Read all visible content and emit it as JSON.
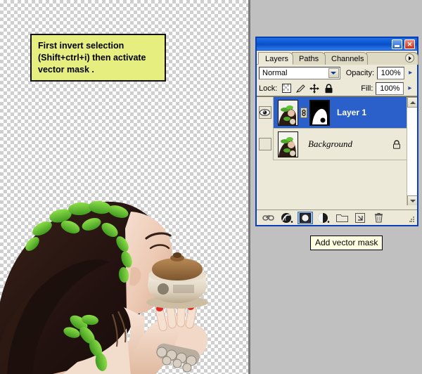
{
  "annotation_note": {
    "lines": [
      "First invert selection",
      "(Shift+ctrl+i) then activate",
      "vector mask ."
    ],
    "background_color": "#e6ee80",
    "border_color": "#111111"
  },
  "canvas": {
    "name": "transparent-canvas",
    "checker_light": "#ffffff",
    "checker_dark": "#cfcfcf",
    "photo_description": "Cut-out photo of a woman with green leaves in her hair holding a ceramic tea bowl"
  },
  "photoshop_panel": {
    "title": "",
    "window_buttons": {
      "minimize": "_",
      "close": "✕"
    },
    "tabs": [
      {
        "label": "Layers",
        "active": true
      },
      {
        "label": "Paths",
        "active": false
      },
      {
        "label": "Channels",
        "active": false
      }
    ],
    "tab_menu_icon": "triangle-right-icon",
    "blend": {
      "mode": "Normal",
      "dropdown_icon": "chevron-down-icon",
      "opacity_label": "Opacity:",
      "opacity_value": "100%",
      "opacity_flyout_icon": "chevron-right-icon"
    },
    "lock": {
      "label": "Lock:",
      "icons": [
        "lock-transparent-pixels-icon",
        "lock-image-pixels-icon",
        "lock-position-icon",
        "lock-all-icon"
      ],
      "fill_label": "Fill:",
      "fill_value": "100%",
      "fill_flyout_icon": "chevron-right-icon"
    },
    "layers": [
      {
        "name": "Layer 1",
        "visible": true,
        "selected": true,
        "has_mask": true,
        "link_icon": "link-chain-icon",
        "locked": false
      },
      {
        "name": "Background",
        "visible": false,
        "selected": false,
        "has_mask": false,
        "locked": true,
        "lock_icon": "padlock-icon"
      }
    ],
    "scrollbar": {
      "up_icon": "chevron-up-icon",
      "down_icon": "chevron-down-icon"
    },
    "bottom_toolbar": [
      {
        "icon": "link-layers-icon",
        "label": "Link layers",
        "pressed": false
      },
      {
        "icon": "layer-style-fx-icon",
        "label": "Add a layer style",
        "pressed": false
      },
      {
        "icon": "add-mask-icon",
        "label": "Add vector mask",
        "pressed": true
      },
      {
        "icon": "adjustment-layer-icon",
        "label": "Create new fill or adjustment layer",
        "pressed": false
      },
      {
        "icon": "new-group-icon",
        "label": "Create a new group",
        "pressed": false
      },
      {
        "icon": "new-layer-icon",
        "label": "Create a new layer",
        "pressed": false
      },
      {
        "icon": "trash-icon",
        "label": "Delete layer",
        "pressed": false
      }
    ],
    "colors": {
      "selection_blue": "#2b5fc9",
      "panel_bg": "#ece9d8",
      "window_border": "#0a3fb5",
      "titlebar_blue": "#0a53d2"
    }
  },
  "tooltip": {
    "text": "Add vector mask",
    "background": "#ffffe1"
  },
  "desktop": {
    "background_color": "#c0c0c0"
  }
}
